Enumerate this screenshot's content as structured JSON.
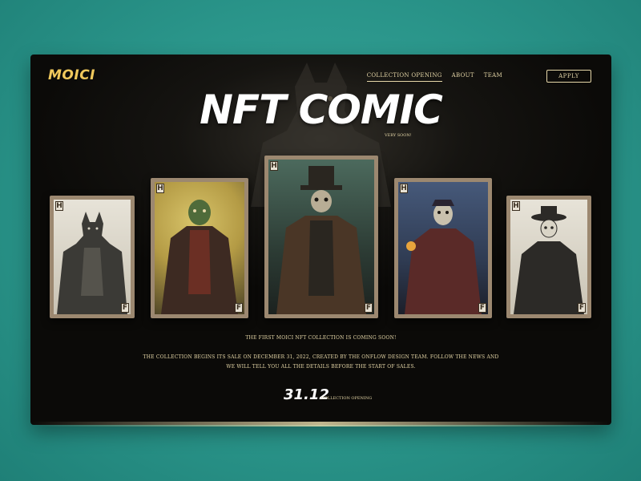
{
  "brand": {
    "logo": "MOICI",
    "accent": "#f1c95c"
  },
  "nav": {
    "items": [
      {
        "label": "Collection Opening",
        "active": true
      },
      {
        "label": "About",
        "active": false
      },
      {
        "label": "Team",
        "active": false
      }
    ],
    "apply_label": "APPLY"
  },
  "hero": {
    "title": "NFT COMIC",
    "subtitle": "VERY SOON!"
  },
  "cards": [
    {
      "corner_top": "H",
      "corner_bottom": "F",
      "character": "werewolf-in-coat",
      "palette": [
        "#d9d4c6",
        "#3b3a36"
      ]
    },
    {
      "corner_top": "H",
      "corner_bottom": "F",
      "character": "green-goblin-gentleman",
      "palette": [
        "#c9b15a",
        "#2f3a22"
      ]
    },
    {
      "corner_top": "H",
      "corner_bottom": "F",
      "character": "top-hat-skeleton",
      "palette": [
        "#3f5a4f",
        "#1f2620"
      ]
    },
    {
      "corner_top": "H",
      "corner_bottom": "F",
      "character": "skeleton-with-torch",
      "palette": [
        "#41536e",
        "#2a2430"
      ]
    },
    {
      "corner_top": "H",
      "corner_bottom": "F",
      "character": "skull-cowboy",
      "palette": [
        "#d9d4c6",
        "#2c2a27"
      ]
    }
  ],
  "info": {
    "headline": "The first Moici NFT collection is coming soon!",
    "body_line1": "The collection begins its sale on December 31, 2022, created by the Onflow Design team. Follow the news and",
    "body_line2": "we will tell you all the details before the start of sales."
  },
  "countdown": {
    "date": "31.12",
    "label": "Collection Opening"
  }
}
